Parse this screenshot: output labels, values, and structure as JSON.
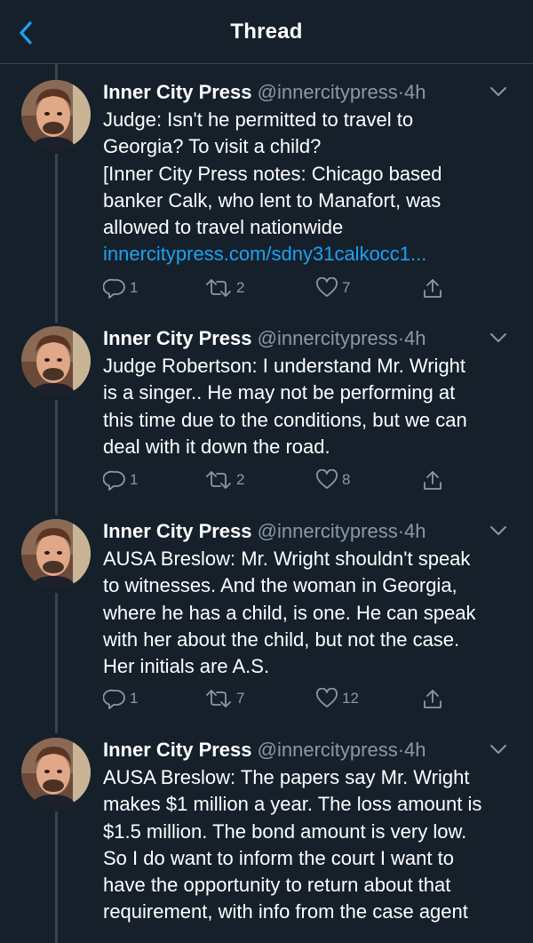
{
  "header": {
    "title": "Thread"
  },
  "tweets": [
    {
      "name": "Inner City Press",
      "handle": "@innercitypress",
      "sep": "·",
      "time": "4h",
      "lines": [
        "Judge: Isn't he permitted to travel to",
        "Georgia? To visit a child?",
        "[Inner City Press notes: Chicago based",
        "banker Calk, who lent to Manafort, was",
        "allowed to travel nationwide"
      ],
      "link": "innercitypress.com/sdny31calkocc1...",
      "replies": "1",
      "retweets": "2",
      "likes": "7"
    },
    {
      "name": "Inner City Press",
      "handle": "@innercitypress",
      "sep": "·",
      "time": "4h",
      "lines": [
        "Judge Robertson: I understand Mr. Wright",
        "is a singer.. He may not be performing at",
        "this time due to the conditions, but we can",
        "deal with it down the road."
      ],
      "replies": "1",
      "retweets": "2",
      "likes": "8"
    },
    {
      "name": "Inner City Press",
      "handle": "@innercitypress",
      "sep": "·",
      "time": "4h",
      "lines": [
        "AUSA Breslow: Mr. Wright shouldn't speak",
        "to witnesses. And the woman in Georgia,",
        "where he has a child, is one. He can speak",
        "with her about the child, but not the case.",
        "Her initials are A.S."
      ],
      "replies": "1",
      "retweets": "7",
      "likes": "12"
    },
    {
      "name": "Inner City Press",
      "handle": "@innercitypress",
      "sep": "·",
      "time": "4h",
      "lines": [
        "AUSA Breslow: The papers say Mr. Wright",
        "makes $1 million a year. The loss amount is",
        "$1.5 million. The bond amount is very low.",
        "So I do want to inform the court I want to",
        "have the opportunity to return about that",
        "requirement, with info from the case agent"
      ]
    }
  ],
  "colors": {
    "background": "#15202b",
    "link": "#1da1f2",
    "muted": "#8899a6",
    "divider": "#38444d"
  },
  "icons": [
    "back-arrow-icon",
    "chevron-down-icon",
    "reply-icon",
    "retweet-icon",
    "like-icon",
    "share-icon"
  ]
}
